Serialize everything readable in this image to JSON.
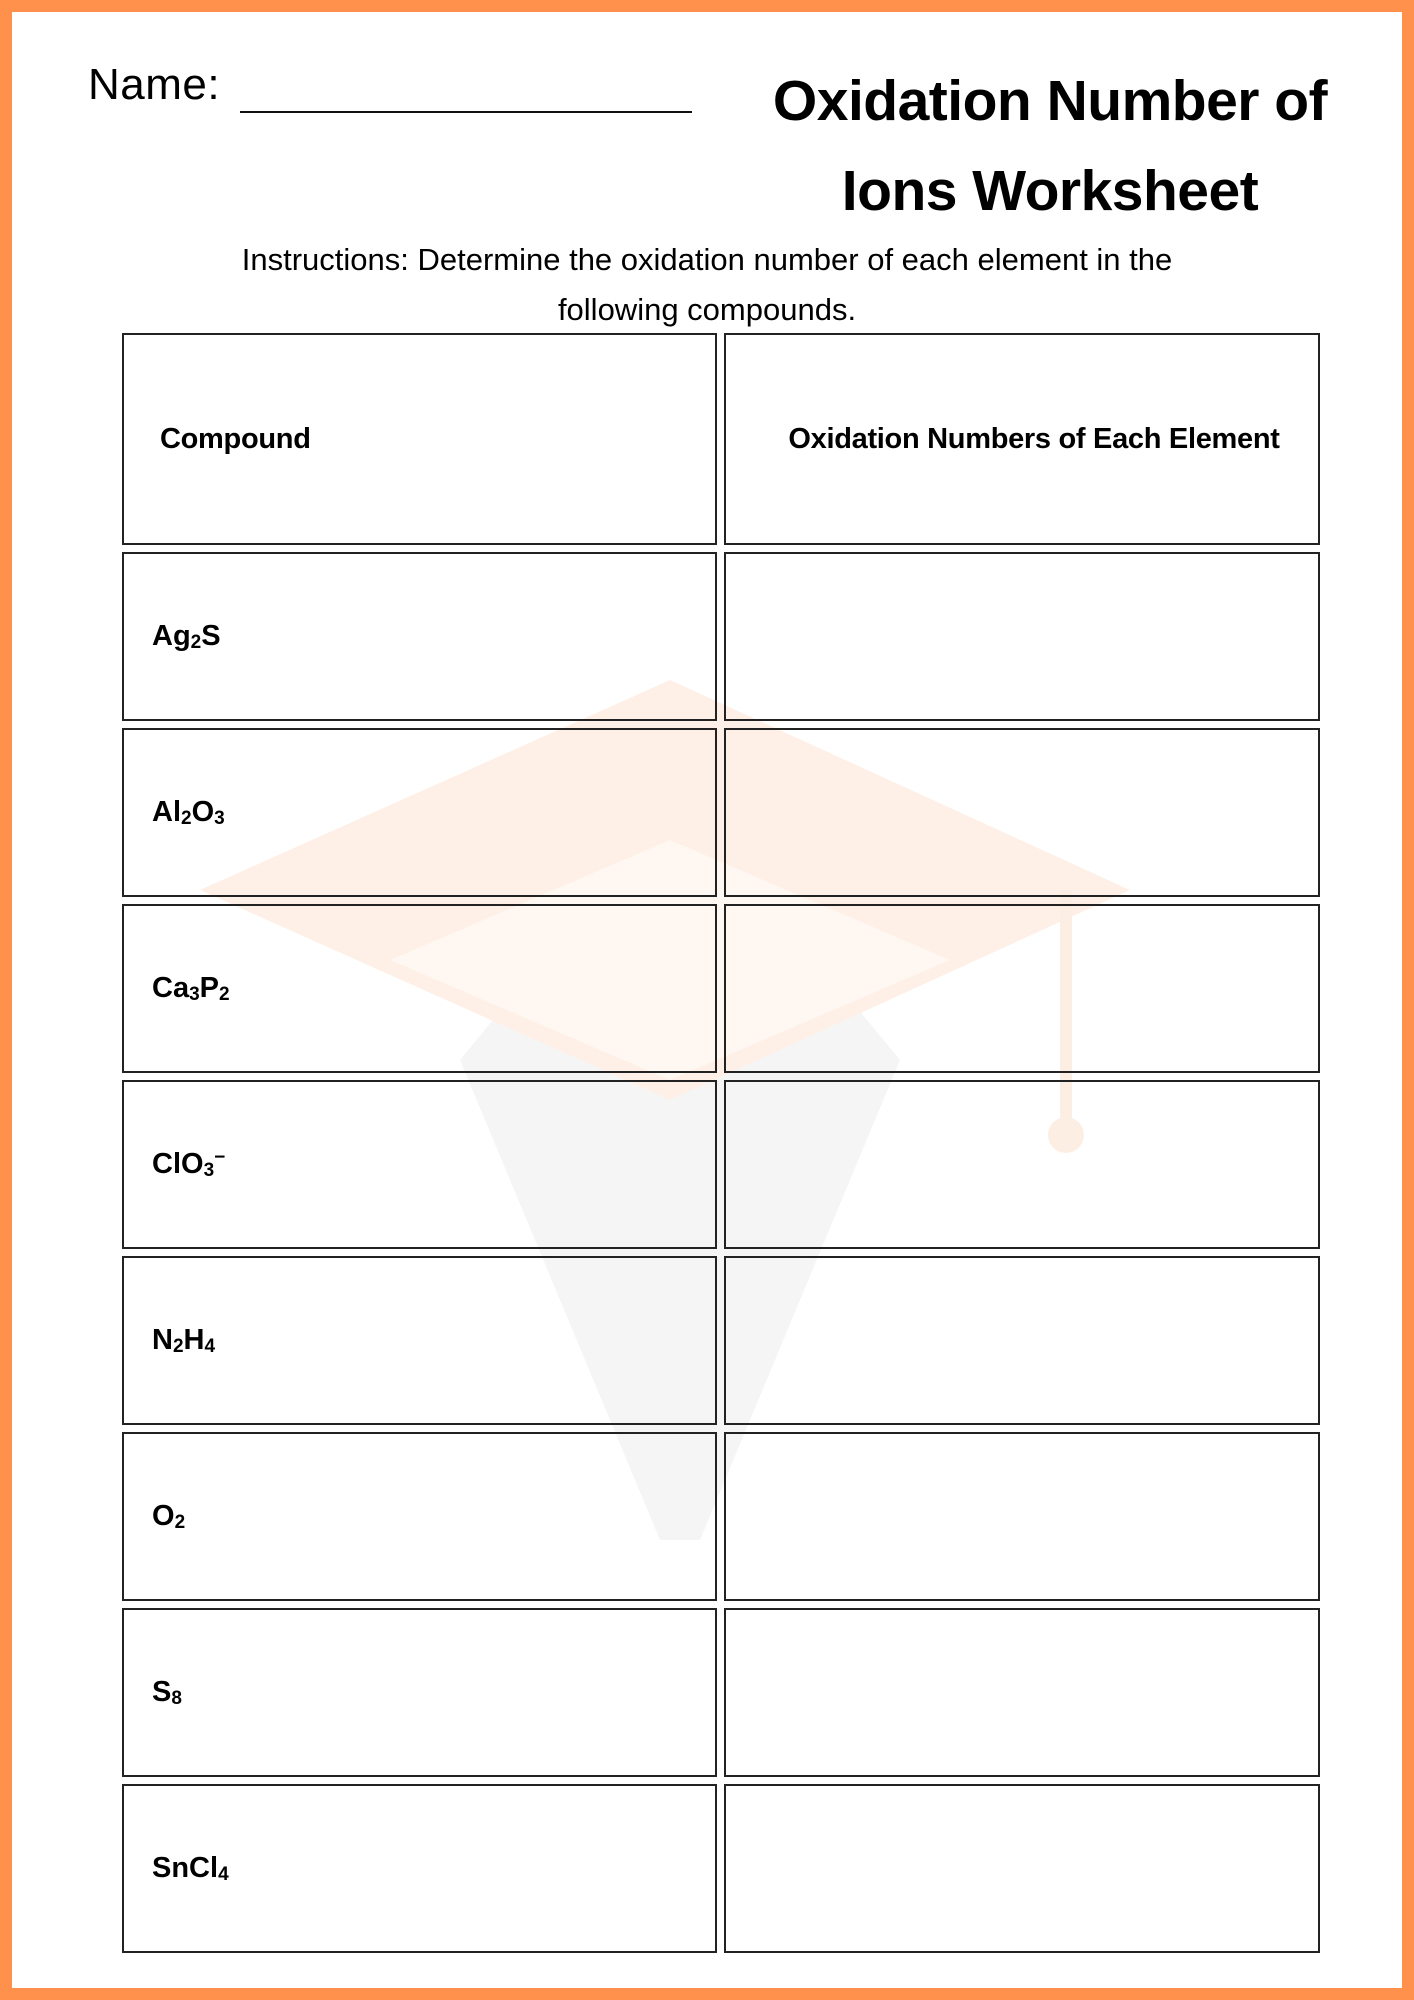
{
  "header": {
    "name_label": "Name:",
    "title_line1": "Oxidation Number of",
    "title_line2": "Ions Worksheet"
  },
  "instructions": {
    "line1": "Instructions: Determine the oxidation number of each element in the",
    "line2": "following compounds."
  },
  "table": {
    "columns": [
      "Compound",
      "Oxidation Numbers of Each Element"
    ],
    "rows": [
      {
        "formula": [
          [
            "Ag",
            ""
          ],
          [
            "2",
            "sub"
          ],
          [
            "S",
            ""
          ]
        ],
        "answer": ""
      },
      {
        "formula": [
          [
            "Al",
            ""
          ],
          [
            "2",
            "sub"
          ],
          [
            "O",
            ""
          ],
          [
            "3",
            "sub"
          ]
        ],
        "answer": ""
      },
      {
        "formula": [
          [
            "Ca",
            ""
          ],
          [
            "3",
            "sub"
          ],
          [
            "P",
            ""
          ],
          [
            "2",
            "sub"
          ]
        ],
        "answer": ""
      },
      {
        "formula": [
          [
            "ClO",
            ""
          ],
          [
            "3",
            "sub"
          ],
          [
            "−",
            "sup"
          ]
        ],
        "answer": ""
      },
      {
        "formula": [
          [
            "N",
            ""
          ],
          [
            "2",
            "sub"
          ],
          [
            "H",
            ""
          ],
          [
            "4",
            "sub"
          ]
        ],
        "answer": ""
      },
      {
        "formula": [
          [
            "O",
            ""
          ],
          [
            "2",
            "sub"
          ]
        ],
        "answer": ""
      },
      {
        "formula": [
          [
            "S",
            ""
          ],
          [
            "8",
            "sub"
          ]
        ],
        "answer": ""
      },
      {
        "formula": [
          [
            "SnCl",
            ""
          ],
          [
            "4",
            "sub"
          ]
        ],
        "answer": ""
      }
    ],
    "formula_text": [
      "Ag2S",
      "Al2O3",
      "Ca3P2",
      "ClO3-",
      "N2H4",
      "O2",
      "S8",
      "SnCl4"
    ]
  },
  "colors": {
    "border": "#FF914D",
    "watermark_cap": "#FDEEE4",
    "watermark_pen": "#F4F4F4"
  },
  "icons": {
    "watermark": "graduation-cap-icon"
  }
}
